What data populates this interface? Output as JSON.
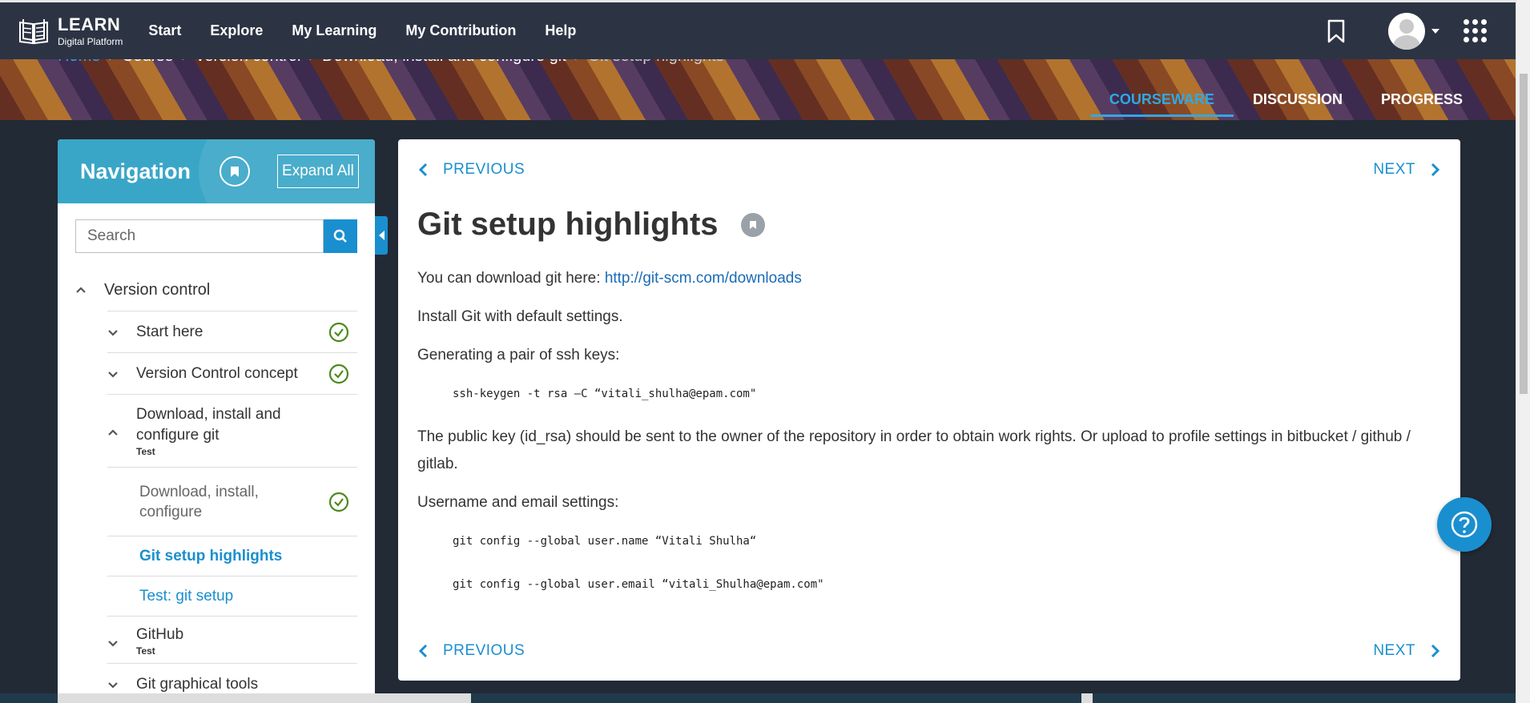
{
  "header": {
    "logo_title": "LEARN",
    "logo_subtitle": "Digital Platform",
    "nav": [
      "Start",
      "Explore",
      "My Learning",
      "My Contribution",
      "Help"
    ]
  },
  "breadcrumb": [
    "Home",
    "Course",
    "Version control",
    "Download, install and configure git",
    "Git setup highlights"
  ],
  "course_tabs": [
    "COURSEWARE",
    "DISCUSSION",
    "PROGRESS"
  ],
  "sidebar": {
    "title": "Navigation",
    "expand_all": "Expand All",
    "search_placeholder": "Search",
    "section": "Version control",
    "subsections": [
      {
        "label": "Start here",
        "completed": true
      },
      {
        "label": "Version Control concept",
        "completed": true
      },
      {
        "label": "Download, install and configure git",
        "tag": "Test",
        "expanded": true
      },
      {
        "label": "GitHub",
        "tag": "Test"
      },
      {
        "label": "Git graphical tools"
      }
    ],
    "units": [
      {
        "label": "Download, install, configure",
        "completed": true
      },
      {
        "label": "Git setup highlights",
        "active": true
      },
      {
        "label": "Test: git setup"
      }
    ]
  },
  "content": {
    "previous": "PREVIOUS",
    "next": "NEXT",
    "title": "Git setup highlights",
    "p1_prefix": "You can download git here: ",
    "p1_link": "http://git-scm.com/downloads",
    "p2": "Install Git with default settings.",
    "p3": "Generating a pair of ssh keys:",
    "code1": "ssh-keygen -t rsa –C “vitali_shulha@epam.com\"",
    "p4": "The public key (id_rsa) should be sent to the owner of the repository in order to obtain work rights. Or upload to profile settings in bitbucket / github / gitlab.",
    "p5": "Username and email settings:",
    "code2": "git config --global user.name “Vitali Shulha“",
    "code3": "git config --global user.email “vitali_Shulha@epam.com\""
  },
  "colors": {
    "accent": "#1a8fcf",
    "topbar": "#2c3444",
    "sidebar_header": "#3aa6c7",
    "check": "#4a8a1e"
  }
}
